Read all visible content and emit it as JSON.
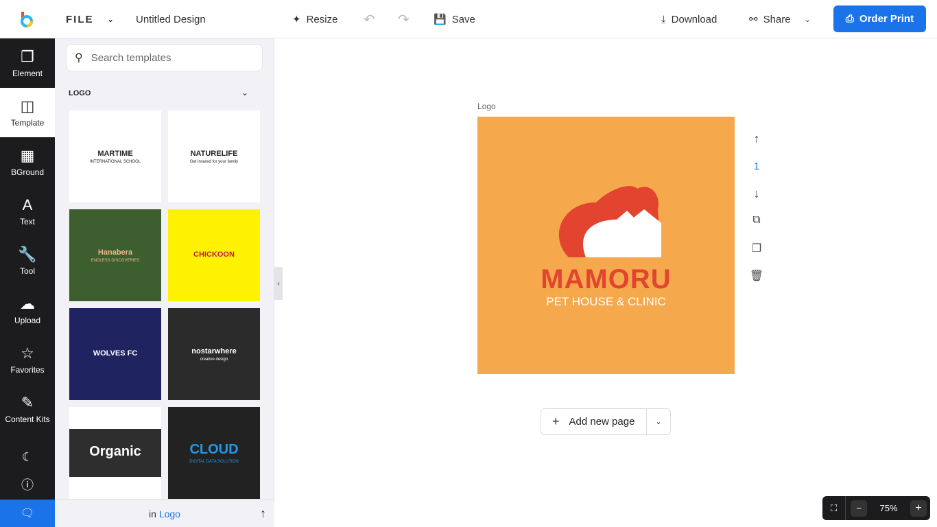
{
  "header": {
    "file": "FILE",
    "title": "Untitled Design",
    "resize": "Resize",
    "save": "Save",
    "download": "Download",
    "share": "Share",
    "order_print": "Order Print",
    "accent": "#1a73e8"
  },
  "rail": [
    {
      "label": "Element",
      "icon": "cubes-icon"
    },
    {
      "label": "Template",
      "icon": "template-icon"
    },
    {
      "label": "BGround",
      "icon": "background-icon"
    },
    {
      "label": "Text",
      "icon": "text-icon"
    },
    {
      "label": "Tool",
      "icon": "wrench-icon"
    },
    {
      "label": "Upload",
      "icon": "cloud-upload-icon"
    },
    {
      "label": "Favorites",
      "icon": "star-icon"
    },
    {
      "label": "Content Kits",
      "icon": "content-kits-icon"
    }
  ],
  "panel": {
    "search_placeholder": "Search templates",
    "category": "LOGO",
    "footer_prefix": "in",
    "footer_link": "Logo",
    "templates": [
      {
        "name": "MARTIME",
        "sub": "INTERNATIONAL SCHOOL",
        "bg": "#ffffff",
        "fg": "#222"
      },
      {
        "name": "NATURELIFE",
        "sub": "Get insured for your family",
        "bg": "#ffffff",
        "fg": "#222"
      },
      {
        "name": "Hanabera",
        "sub": "ENDLESS DISCOVERIES",
        "bg": "#3d5e2e",
        "fg": "#f2b88a"
      },
      {
        "name": "CHICKOON",
        "sub": "",
        "bg": "#fff200",
        "fg": "#c2185b"
      },
      {
        "name": "WOLVES FC",
        "sub": "",
        "bg": "#1f2460",
        "fg": "#ffffff"
      },
      {
        "name": "nostarwhere",
        "sub": "creative design",
        "bg": "#2b2b2b",
        "fg": "#ffffff"
      },
      {
        "name": "Organic",
        "sub": "",
        "bg": "#2e2e2e",
        "fg": "#ffffff"
      },
      {
        "name": "CLOUD",
        "sub": "DIGITAL DATA SOLUTION",
        "bg": "#222222",
        "fg": "#1e9be8"
      }
    ]
  },
  "canvas": {
    "page_label": "Logo",
    "page_number": "1",
    "design_title": "MAMORU",
    "design_sub": "PET HOUSE & CLINIC",
    "design_bg": "#f5a94c",
    "add_page": "Add new page"
  },
  "zoom": {
    "level": "75%"
  }
}
